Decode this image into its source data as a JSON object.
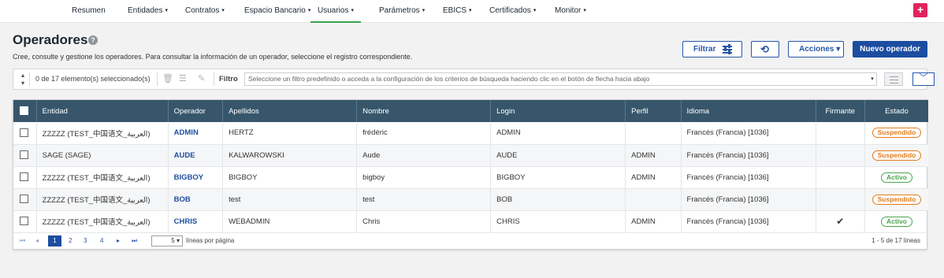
{
  "nav": {
    "items": [
      {
        "label": "Resumen",
        "caret": ""
      },
      {
        "label": "Entidades",
        "caret": "▾"
      },
      {
        "label": "Contratos",
        "caret": "▾"
      },
      {
        "label": "Espacio Bancario",
        "caret": "▾"
      },
      {
        "label": "Usuarios",
        "caret": "▾"
      },
      {
        "label": "Parámetros",
        "caret": "▾"
      },
      {
        "label": "EBICS",
        "caret": "▾"
      },
      {
        "label": "Certificados",
        "caret": "▾"
      },
      {
        "label": "Monitor",
        "caret": "▾"
      }
    ],
    "active": "Usuarios",
    "plus_label": "+"
  },
  "page": {
    "title": "Operadores",
    "help": "?",
    "subtitle": "Cree, consulte y gestione los operadores. Para consultar la información de un operador, seleccione el registro correspondiente."
  },
  "actions": {
    "filter_label": "Filtrar",
    "refresh_icon": "⟲",
    "actions_label": "Acciones ▾",
    "new_label": "Nuevo operador"
  },
  "toolbar": {
    "selected_text": "0 de 17 elemento(s) seleccionado(s)",
    "filter_label": "Filtro",
    "filter_placeholder": "Seleccione un filtro predefinido o acceda a la configuración de los criterios de búsqueda haciendo clic en el botón de flecha hacia abajo",
    "dropdown_caret": "▾",
    "expand_caret": "﹀"
  },
  "table": {
    "columns": [
      "Entidad",
      "Operador",
      "Apellidos",
      "Nombre",
      "Login",
      "Perfil",
      "Idioma",
      "Firmante",
      "Estado"
    ],
    "rows": [
      {
        "entidad": "ZZZZZ (TEST_中国语文_العربية)",
        "operador": "ADMIN",
        "apellidos": "HERTZ",
        "nombre": "frédéric",
        "login": "ADMIN",
        "perfil": "",
        "idioma": "Francés (Francia) [1036]",
        "firmante": "",
        "estado": "Suspendido",
        "estado_type": "susp"
      },
      {
        "entidad": "SAGE (SAGE)",
        "operador": "AUDE",
        "apellidos": "KALWAROWSKI",
        "nombre": "Aude",
        "login": "AUDE",
        "perfil": "ADMIN",
        "idioma": "Francés (Francia) [1036]",
        "firmante": "",
        "estado": "Suspendido",
        "estado_type": "susp"
      },
      {
        "entidad": "ZZZZZ (TEST_中国语文_العربية)",
        "operador": "BIGBOY",
        "apellidos": "BIGBOY",
        "nombre": "bigboy",
        "login": "BIGBOY",
        "perfil": "ADMIN",
        "idioma": "Francés (Francia) [1036]",
        "firmante": "",
        "estado": "Activo",
        "estado_type": "act"
      },
      {
        "entidad": "ZZZZZ (TEST_中国语文_العربية)",
        "operador": "BOB",
        "apellidos": "test",
        "nombre": "test",
        "login": "BOB",
        "perfil": "",
        "idioma": "Francés (Francia) [1036]",
        "firmante": "",
        "estado": "Suspendido",
        "estado_type": "susp"
      },
      {
        "entidad": "ZZZZZ (TEST_中国语文_العربية)",
        "operador": "CHRIS",
        "apellidos": "WEBADMIN",
        "nombre": "Chris",
        "login": "CHRIS",
        "perfil": "ADMIN",
        "idioma": "Francés (Francia) [1036]",
        "firmante": "✔",
        "estado": "Activo",
        "estado_type": "act"
      }
    ]
  },
  "pagination": {
    "first": "⏮",
    "prev": "◂",
    "pages": [
      "1",
      "2",
      "3",
      "4"
    ],
    "current": "1",
    "next": "▸",
    "last": "⏭",
    "page_size": "5",
    "lines_label": "líneas por página",
    "range_label": "1 - 5 de 17 líneas"
  },
  "colors": {
    "header_bg": "#37566b",
    "primary": "#1c4da0",
    "accent_plus": "#e0245e",
    "active_underline": "#3aa54c",
    "status_suspended": "#e07b1a",
    "status_active": "#4aa54f"
  }
}
